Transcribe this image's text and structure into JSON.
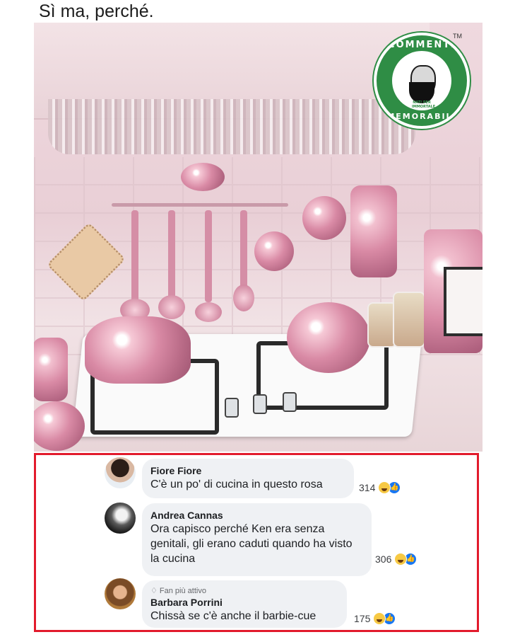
{
  "post": {
    "caption": "Sì ma, perché."
  },
  "logo": {
    "top_text": "COMMENTI",
    "bottom_text": "MEMORABILI",
    "small_text": "NATI PER IMMORTALE",
    "tm": "TM"
  },
  "comments": [
    {
      "author": "Fiore Fiore",
      "badge": "",
      "text": "C'è un po' di cucina in questo rosa",
      "reactions": "314",
      "reaction_icons": [
        "haha-icon",
        "like-icon"
      ]
    },
    {
      "author": "Andrea Cannas",
      "badge": "",
      "text": "Ora capisco perché Ken era senza genitali, gli erano caduti quando ha visto la cucina",
      "reactions": "306",
      "reaction_icons": [
        "haha-icon",
        "like-icon"
      ]
    },
    {
      "author": "Barbara Porrini",
      "badge": "Fan più attivo",
      "text": "Chissà se c'è anche il barbie-cue",
      "reactions": "175",
      "reaction_icons": [
        "haha-icon",
        "like-icon"
      ]
    }
  ],
  "colors": {
    "highlight_border": "#e21b2c",
    "logo_green": "#2f8d45",
    "bubble_bg": "#eff1f4"
  }
}
